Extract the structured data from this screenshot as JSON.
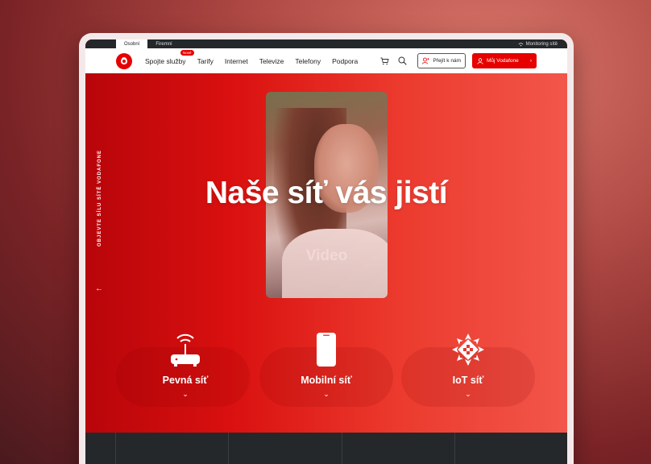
{
  "topbar": {
    "tabs": [
      {
        "label": "Osobní"
      },
      {
        "label": "Firemní"
      }
    ],
    "monitoring": "Monitoring sítě"
  },
  "nav": {
    "items": [
      {
        "label": "Spojte služby",
        "badge": "Nové"
      },
      {
        "label": "Tarify"
      },
      {
        "label": "Internet"
      },
      {
        "label": "Televize"
      },
      {
        "label": "Telefony"
      },
      {
        "label": "Podpora"
      }
    ],
    "contact_label": "Přejít k nám",
    "account_label": "Můj Vodafone"
  },
  "hero": {
    "headline": "Naše síť vás jistí",
    "video_label": "Video",
    "side_text": "OBJEVTE SÍLU SÍTĚ VODAFONE",
    "features": [
      {
        "label": "Pevná síť",
        "icon": "router-icon"
      },
      {
        "label": "Mobilní síť",
        "icon": "phone-icon"
      },
      {
        "label": "IoT síť",
        "icon": "iot-icon"
      }
    ]
  },
  "colors": {
    "brand": "#e60000",
    "dark": "#25282b"
  }
}
